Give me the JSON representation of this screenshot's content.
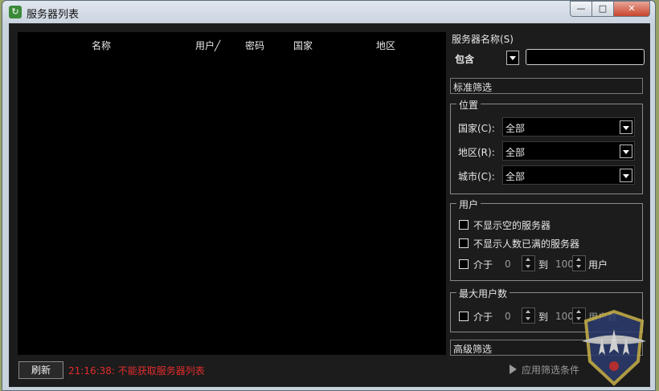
{
  "window": {
    "title": "服务器列表",
    "min": "—",
    "max": "□",
    "close": "✕"
  },
  "list": {
    "columns": [
      "名称",
      "用户",
      "密码",
      "国家",
      "地区"
    ],
    "sort_marker": "╱"
  },
  "filter": {
    "server_name_label": "服务器名称(S)",
    "match_mode": "包含",
    "server_name_value": "",
    "standard_label": "标准筛选",
    "location": {
      "legend": "位置",
      "country_label": "国家(C):",
      "country_value": "全部",
      "region_label": "地区(R):",
      "region_value": "全部",
      "city_label": "城市(C):",
      "city_value": "全部"
    },
    "users": {
      "legend": "用户",
      "hide_empty": "不显示空的服务器",
      "hide_full": "不显示人数已满的服务器",
      "between": "介于",
      "min": "0",
      "to": "到",
      "max": "100",
      "unit": "用户"
    },
    "max_users": {
      "legend": "最大用户数",
      "between": "介于",
      "min": "0",
      "to": "到",
      "max": "100",
      "unit": "用户数"
    },
    "advanced_label": "高级筛选"
  },
  "bottom": {
    "refresh": "刷新",
    "status": "21:16:38: 不能获取服务器列表",
    "apply": "应用筛选条件"
  },
  "colors": {
    "status_error": "#e22c2c",
    "panel_bg": "#1c1c1c",
    "list_bg": "#000000"
  }
}
